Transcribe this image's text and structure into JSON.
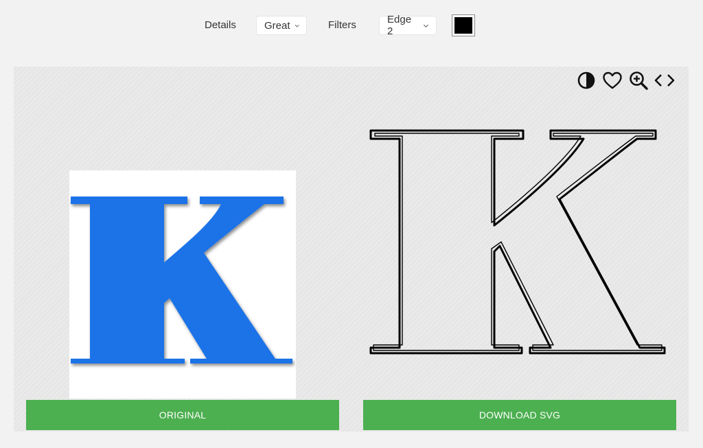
{
  "toolbar": {
    "details_label": "Details",
    "details_value": "Great",
    "filters_label": "Filters",
    "filters_value": "Edge 2",
    "color_value": "#000000"
  },
  "tools": {
    "contrast": "contrast-icon",
    "favorite": "heart-icon",
    "zoom": "zoom-in-icon",
    "code": "code-icon"
  },
  "preview": {
    "letter": "K",
    "original_color": "#1a73e8",
    "outline_color": "#000000"
  },
  "buttons": {
    "original_label": "ORIGINAL",
    "download_label": "DOWNLOAD SVG",
    "button_color": "#4caf50"
  }
}
